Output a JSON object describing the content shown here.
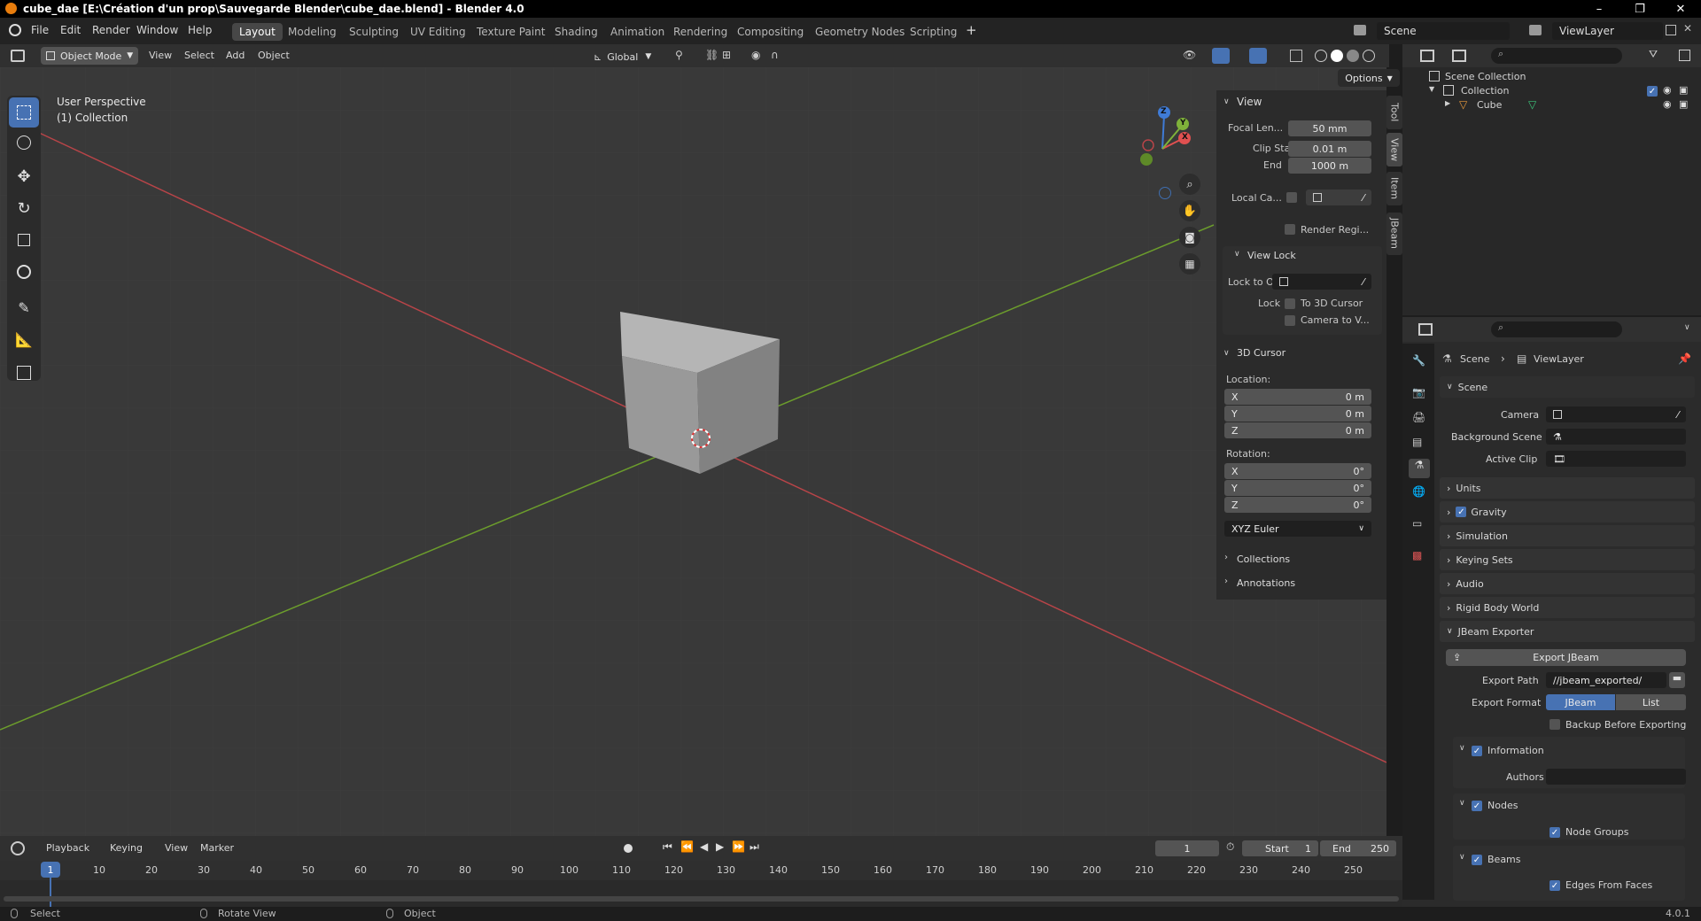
{
  "window": {
    "title": "cube_dae [E:\\Création d'un prop\\Sauvegarde Blender\\cube_dae.blend] - Blender 4.0",
    "minimize": "–",
    "restore": "❐",
    "close": "✕"
  },
  "menu": [
    "File",
    "Edit",
    "Render",
    "Window",
    "Help"
  ],
  "workspaces": [
    "Layout",
    "Modeling",
    "Sculpting",
    "UV Editing",
    "Texture Paint",
    "Shading",
    "Animation",
    "Rendering",
    "Compositing",
    "Geometry Nodes",
    "Scripting"
  ],
  "active_workspace": "Layout",
  "add_workspace": "+",
  "scene_selector": "Scene",
  "viewlayer_selector": "ViewLayer",
  "viewport_header": {
    "mode": "Object Mode",
    "menus": [
      "View",
      "Select",
      "Add",
      "Object"
    ],
    "transform_orientation": "Global",
    "options": "Options"
  },
  "viewport": {
    "info_line1": "User Perspective",
    "info_line2": "(1) Collection",
    "gizmo": {
      "z": "Z",
      "y": "Y",
      "x": "X"
    }
  },
  "npanel": {
    "tabs": [
      "Tool",
      "View",
      "Item",
      "JBeam"
    ],
    "view_header": "View",
    "focal_length_label": "Focal Len...",
    "focal_length": "50 mm",
    "clip_start_label": "Clip Start",
    "clip_start": "0.01 m",
    "clip_end_label": "End",
    "clip_end": "1000 m",
    "local_camera_label": "Local Ca...",
    "render_region_label": "Render Regi...",
    "view_lock_header": "View Lock",
    "lock_to_object_label": "Lock to O...",
    "lock_label": "Lock",
    "to_3d_cursor": "To 3D Cursor",
    "camera_to_view": "Camera to V...",
    "cursor_header": "3D Cursor",
    "location_label": "Location:",
    "loc": [
      {
        "axis": "X",
        "value": "0 m"
      },
      {
        "axis": "Y",
        "value": "0 m"
      },
      {
        "axis": "Z",
        "value": "0 m"
      }
    ],
    "rotation_label": "Rotation:",
    "rot": [
      {
        "axis": "X",
        "value": "0°"
      },
      {
        "axis": "Y",
        "value": "0°"
      },
      {
        "axis": "Z",
        "value": "0°"
      }
    ],
    "rotation_mode": "XYZ Euler",
    "collections": "Collections",
    "annotations": "Annotations"
  },
  "outliner": {
    "root": "Scene Collection",
    "collection": "Collection",
    "object": "Cube"
  },
  "properties": {
    "breadcrumb_scene": "Scene",
    "breadcrumb_viewlayer": "ViewLayer",
    "scene_header": "Scene",
    "camera_label": "Camera",
    "background_scene_label": "Background Scene",
    "active_clip_label": "Active Clip",
    "panels": [
      "Units",
      "Gravity",
      "Simulation",
      "Keying Sets",
      "Audio",
      "Rigid Body World"
    ],
    "jbeam_header": "JBeam Exporter",
    "export_button": "Export JBeam",
    "export_path_label": "Export Path",
    "export_path": "//jbeam_exported/",
    "export_format_label": "Export Format",
    "format_options": [
      "JBeam",
      "List"
    ],
    "backup_label": "Backup Before Exporting",
    "information_label": "Information",
    "authors_label": "Authors",
    "nodes_label": "Nodes",
    "node_groups_label": "Node Groups",
    "beams_label": "Beams",
    "edges_from_faces_label": "Edges From Faces"
  },
  "timeline": {
    "menus": [
      "Playback",
      "Keying",
      "View",
      "Marker"
    ],
    "current_frame": "1",
    "start_label": "Start",
    "start": "1",
    "end_label": "End",
    "end": "250",
    "ruler": [
      "10",
      "20",
      "30",
      "40",
      "50",
      "60",
      "70",
      "80",
      "90",
      "100",
      "110",
      "120",
      "130",
      "140",
      "150",
      "160",
      "170",
      "180",
      "190",
      "200",
      "210",
      "220",
      "230",
      "240",
      "250"
    ],
    "playhead": "1"
  },
  "status": {
    "select": "Select",
    "rotate": "Rotate View",
    "object": "Object",
    "version": "4.0.1"
  }
}
